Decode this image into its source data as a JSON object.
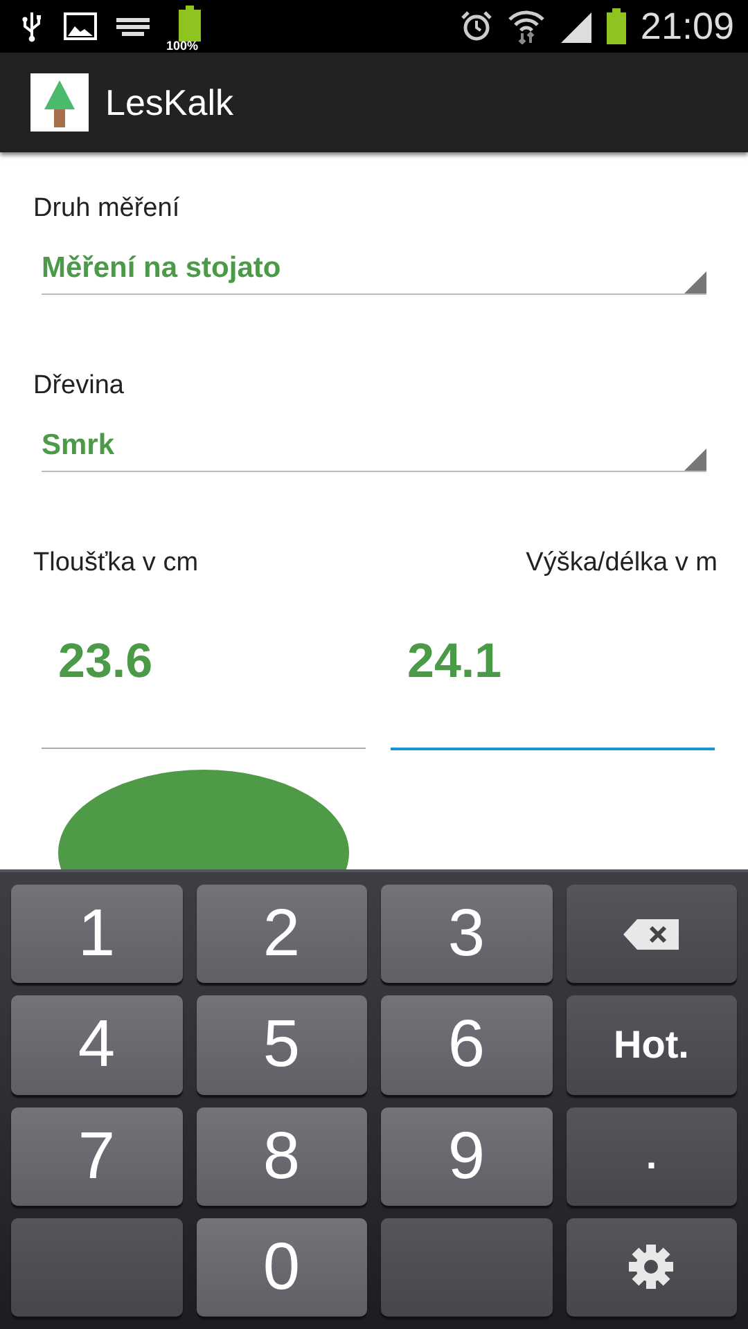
{
  "status_bar": {
    "battery_small_label": "100%",
    "time": "21:09"
  },
  "action_bar": {
    "title": "LesKalk"
  },
  "spinners": [
    {
      "label": "Druh měření",
      "value": "Měření na stojato"
    },
    {
      "label": "Dřevina",
      "value": "Smrk"
    }
  ],
  "inputs": [
    {
      "label": "Tloušťka v cm",
      "value": "23.6",
      "focused": false
    },
    {
      "label": "Výška/délka v m",
      "value": "24.1",
      "focused": true
    }
  ],
  "keyboard": [
    {
      "kind": "digit",
      "text": "1"
    },
    {
      "kind": "digit",
      "text": "2"
    },
    {
      "kind": "digit",
      "text": "3"
    },
    {
      "kind": "backspace"
    },
    {
      "kind": "digit",
      "text": "4"
    },
    {
      "kind": "digit",
      "text": "5"
    },
    {
      "kind": "digit",
      "text": "6"
    },
    {
      "kind": "label",
      "text": "Hot."
    },
    {
      "kind": "digit",
      "text": "7"
    },
    {
      "kind": "digit",
      "text": "8"
    },
    {
      "kind": "digit",
      "text": "9"
    },
    {
      "kind": "label",
      "text": "."
    },
    {
      "kind": "blank"
    },
    {
      "kind": "digit",
      "text": "0"
    },
    {
      "kind": "blank"
    },
    {
      "kind": "gear"
    }
  ]
}
